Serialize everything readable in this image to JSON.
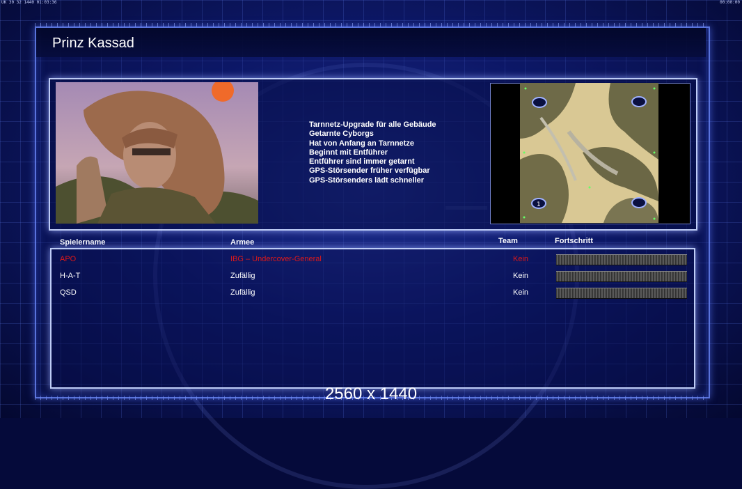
{
  "hud": {
    "top_left": "UK 30 32 1440 01:03:36",
    "top_right": "00:00:00"
  },
  "header": {
    "title": "Prinz Kassad"
  },
  "general": {
    "bullets": [
      "Tarnnetz-Upgrade für alle Gebäude",
      "Getarnte Cyborgs",
      "Hat von Anfang an Tarnnetze",
      "Beginnt mit Entführer",
      "Entführer sind immer getarnt",
      "GPS-Störsender früher verfügbar",
      "GPS-Störsenders lädt schneller"
    ]
  },
  "minimap": {
    "start_marker_label": "1"
  },
  "players_table": {
    "headers": {
      "name": "Spielername",
      "army": "Armee",
      "team": "Team",
      "progress": "Fortschritt"
    },
    "rows": [
      {
        "name": "APO",
        "army": "IBG – Undercover-General",
        "team": "Kein",
        "color": "#e01818"
      },
      {
        "name": "H-A-T",
        "army": "Zufällig",
        "team": "Kein",
        "color": "#ffffff"
      },
      {
        "name": "QSD",
        "army": "Zufällig",
        "team": "Kein",
        "color": "#ffffff"
      }
    ]
  },
  "footer": {
    "resolution": "2560 x 1440"
  }
}
